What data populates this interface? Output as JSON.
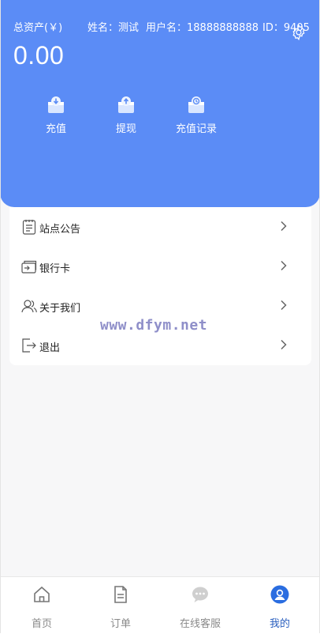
{
  "header": {
    "total_assets_label": "总资产(￥)",
    "name_text": "姓名：测试",
    "username_text": "用户名：18888888888",
    "id_text": "ID：9405",
    "balance": "0.00"
  },
  "actions": [
    {
      "label": "充值",
      "icon": "wallet-deposit-icon"
    },
    {
      "label": "提现",
      "icon": "wallet-withdraw-icon"
    },
    {
      "label": "充值记录",
      "icon": "wallet-history-icon"
    }
  ],
  "menu": {
    "items": [
      {
        "label": "站点公告",
        "icon": "notice-icon"
      },
      {
        "label": "银行卡",
        "icon": "bank-card-icon"
      },
      {
        "label": "关于我们",
        "icon": "users-icon"
      },
      {
        "label": "退出",
        "icon": "logout-icon"
      }
    ]
  },
  "watermark": "www.dfym.net",
  "tabbar": {
    "tabs": [
      {
        "label": "首页",
        "icon": "home-icon"
      },
      {
        "label": "订单",
        "icon": "document-icon"
      },
      {
        "label": "在线客服",
        "icon": "chat-icon"
      },
      {
        "label": "我的",
        "icon": "user-circle-icon",
        "active": true
      }
    ]
  },
  "colors": {
    "primary": "#5b8cf6",
    "active_tab": "#2a5fbf",
    "background": "#f7f7f8"
  }
}
